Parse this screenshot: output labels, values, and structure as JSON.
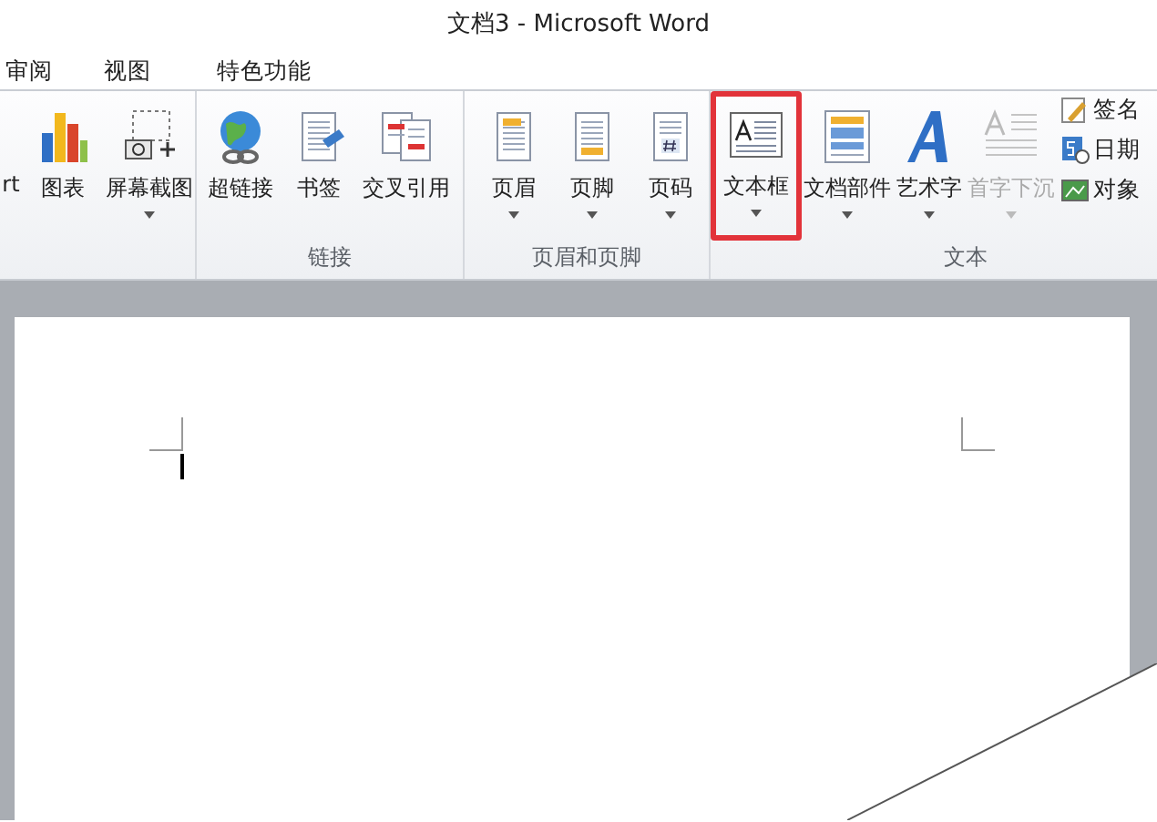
{
  "window": {
    "title": "文档3 - Microsoft Word"
  },
  "tabs": [
    {
      "label": "审阅",
      "selected": false
    },
    {
      "label": "视图",
      "selected": false
    },
    {
      "label": "特色功能",
      "selected": false
    }
  ],
  "ribbon": {
    "groups": [
      {
        "buttons": [
          {
            "kind": "partial",
            "label": "rt",
            "dropdown": false,
            "disabled": false,
            "highlighted": false
          },
          {
            "kind": "chart",
            "label": "图表",
            "dropdown": false,
            "disabled": false,
            "highlighted": false
          },
          {
            "kind": "screenshot",
            "label": "屏幕截图",
            "dropdown": true,
            "disabled": false,
            "highlighted": false
          }
        ]
      },
      {
        "label": "链接",
        "buttons": [
          {
            "kind": "hyperlink",
            "label": "超链接",
            "dropdown": false,
            "disabled": false,
            "highlighted": false
          },
          {
            "kind": "bookmark",
            "label": "书签",
            "dropdown": false,
            "disabled": false,
            "highlighted": false
          },
          {
            "kind": "crossref",
            "label": "交叉引用",
            "dropdown": false,
            "disabled": false,
            "highlighted": false
          }
        ]
      },
      {
        "label": "页眉和页脚",
        "buttons": [
          {
            "kind": "header",
            "label": "页眉",
            "dropdown": true,
            "disabled": false,
            "highlighted": false
          },
          {
            "kind": "footer",
            "label": "页脚",
            "dropdown": true,
            "disabled": false,
            "highlighted": false
          },
          {
            "kind": "pagenumber",
            "label": "页码",
            "dropdown": true,
            "disabled": false,
            "highlighted": false
          }
        ]
      },
      {
        "label": "文本",
        "buttons": [
          {
            "kind": "textbox",
            "label": "文本框",
            "dropdown": true,
            "disabled": false,
            "highlighted": true
          },
          {
            "kind": "quickparts",
            "label": "文档部件",
            "dropdown": true,
            "disabled": false,
            "highlighted": false
          },
          {
            "kind": "wordart",
            "label": "艺术字",
            "dropdown": true,
            "disabled": false,
            "highlighted": false
          },
          {
            "kind": "dropcap",
            "label": "首字下沉",
            "dropdown": true,
            "disabled": true,
            "highlighted": false
          }
        ],
        "small_buttons": [
          {
            "kind": "signature",
            "label": "签名"
          },
          {
            "kind": "datetime",
            "label": "日期"
          },
          {
            "kind": "object",
            "label": "对象"
          }
        ]
      }
    ]
  }
}
